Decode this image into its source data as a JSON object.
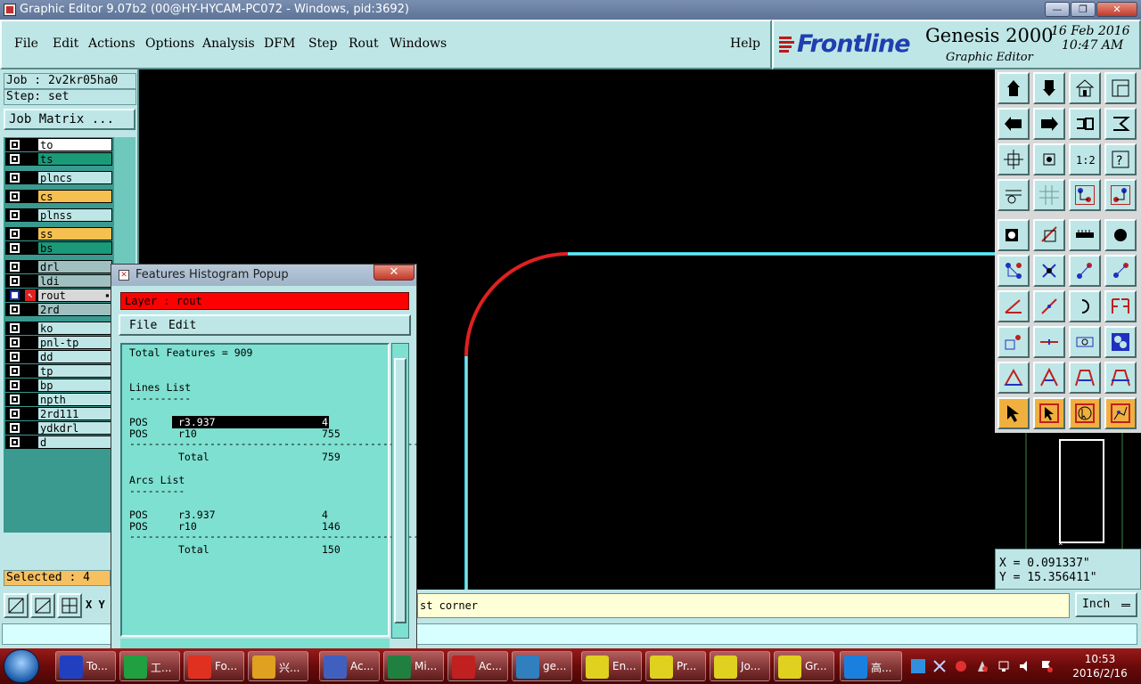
{
  "window": {
    "title": "Graphic Editor 9.07b2 (00@HY-HYCAM-PC072 - Windows, pid:3692)",
    "minimize_label": "—",
    "restore_label": "❐",
    "close_label": "✕"
  },
  "menu": {
    "items": [
      "File",
      "Edit",
      "Actions",
      "Options",
      "Analysis",
      "DFM",
      "Step",
      "Rout",
      "Windows"
    ],
    "help": "Help"
  },
  "logo": {
    "brand": "Frontline",
    "product": "Genesis 2000",
    "product_sub": "Graphic Editor",
    "date": "16 Feb 2016",
    "time": "10:47 AM"
  },
  "left_panel": {
    "job": "Job : 2v2kr05ha0",
    "step": "Step: set",
    "job_matrix": "Job Matrix ...",
    "selected": "Selected : 4"
  },
  "layers": [
    {
      "name": "to",
      "color": "#ffffff"
    },
    {
      "name": "ts",
      "color": "#1a9a78"
    },
    {
      "name": "plncs",
      "color": "#bfe6e6"
    },
    {
      "name": "cs",
      "color": "#f6c050"
    },
    {
      "name": "plnss",
      "color": "#bfe6e6"
    },
    {
      "name": "ss",
      "color": "#f6c050"
    },
    {
      "name": "bs",
      "color": "#1a9a78"
    },
    {
      "name": "drl",
      "color": "#a0c0c0"
    },
    {
      "name": "ldi",
      "color": "#a0c0c0"
    },
    {
      "name": "rout",
      "color": "#d8d8d8"
    },
    {
      "name": "2rd",
      "color": "#a0c0c0"
    },
    {
      "name": "ko",
      "color": "#bfe6e6"
    },
    {
      "name": "pnl-tp",
      "color": "#bfe6e6"
    },
    {
      "name": "dd",
      "color": "#bfe6e6"
    },
    {
      "name": "tp",
      "color": "#bfe6e6"
    },
    {
      "name": "bp",
      "color": "#bfe6e6"
    },
    {
      "name": "npth",
      "color": "#bfe6e6"
    },
    {
      "name": "2rd111",
      "color": "#bfe6e6"
    },
    {
      "name": "ydkdrl",
      "color": "#bfe6e6"
    },
    {
      "name": "d",
      "color": "#bfe6e6"
    }
  ],
  "coords": {
    "x": "X = 0.091337\"",
    "y": "Y = 15.356411\""
  },
  "bottom": {
    "xy_label": "X Y",
    "prompt": "st corner",
    "units": "Inch"
  },
  "popup": {
    "title": "Features Histogram Popup",
    "close": "✕",
    "layer": "Layer :  rout",
    "menu_file": "File",
    "menu_edit": "Edit",
    "total_features": "Total Features = 909",
    "lines_heading": "Lines List",
    "lines_underline": "----------",
    "lines": [
      {
        "pol": "POS",
        "sym": "r3.937",
        "count": "4"
      },
      {
        "pol": "POS",
        "sym": "r10",
        "count": "755"
      }
    ],
    "lines_total_label": "Total",
    "lines_total": "759",
    "arcs_heading": "Arcs List",
    "arcs_underline": "---------",
    "arcs": [
      {
        "pol": "POS",
        "sym": "r3.937",
        "count": "4"
      },
      {
        "pol": "POS",
        "sym": "r10",
        "count": "146"
      }
    ],
    "arcs_total_label": "Total",
    "arcs_total": "150",
    "divider": "------------------------------------------------"
  },
  "taskbar": {
    "tasks": [
      {
        "label": "To...",
        "color": "#2040c0"
      },
      {
        "label": "工...",
        "color": "#20a040"
      },
      {
        "label": "Fo...",
        "color": "#e03020"
      },
      {
        "label": "兴...",
        "color": "#e0a020"
      },
      {
        "label": "Ac...",
        "color": "#4060c0"
      },
      {
        "label": "Mi...",
        "color": "#208040"
      },
      {
        "label": "Ac...",
        "color": "#c02020"
      },
      {
        "label": "ge...",
        "color": "#3080c0"
      },
      {
        "label": "En...",
        "color": "#e0d020"
      },
      {
        "label": "Pr...",
        "color": "#e0d020"
      },
      {
        "label": "Jo...",
        "color": "#e0d020"
      },
      {
        "label": "Gr...",
        "color": "#e0d020"
      },
      {
        "label": "高...",
        "color": "#1a80e0"
      }
    ],
    "clock_time": "10:53",
    "clock_date": "2016/2/16"
  },
  "colors": {
    "panel": "#bfe6e6",
    "route_line": "#2ec8d8",
    "selected_arc": "#e02020",
    "layer_bar": "#ff0000",
    "selected_field": "#f6c060"
  }
}
